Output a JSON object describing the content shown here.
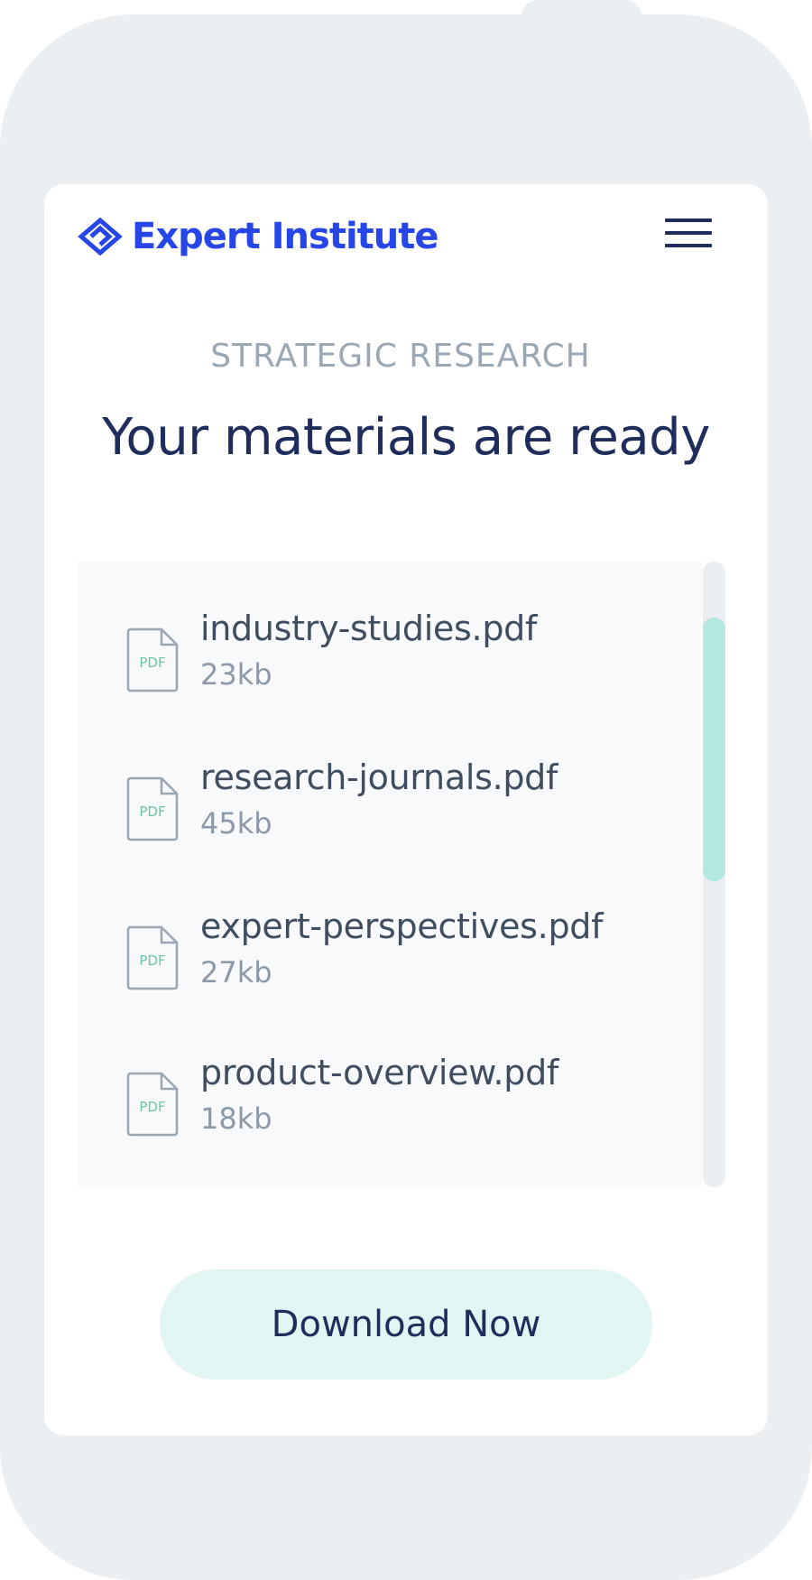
{
  "brand": {
    "name": "Expert Institute",
    "icon": "expert-institute-logo-mark",
    "color": "#2746e8"
  },
  "header": {
    "menu_icon": "hamburger-menu-icon"
  },
  "hero": {
    "eyebrow": "STRATEGIC RESEARCH",
    "title": "Your materials are ready"
  },
  "files": [
    {
      "name": "industry-studies.pdf",
      "size": "23kb",
      "icon_label": "PDF",
      "icon": "pdf-file-icon"
    },
    {
      "name": "research-journals.pdf",
      "size": "45kb",
      "icon_label": "PDF",
      "icon": "pdf-file-icon"
    },
    {
      "name": "expert-perspectives.pdf",
      "size": "27kb",
      "icon_label": "PDF",
      "icon": "pdf-file-icon"
    },
    {
      "name": "product-overview.pdf",
      "size": "18kb",
      "icon_label": "PDF",
      "icon": "pdf-file-icon"
    }
  ],
  "actions": {
    "download_label": "Download Now"
  },
  "colors": {
    "heading": "#1e2d5b",
    "muted": "#9aa7b4",
    "accent_teal": "#b4e7e1",
    "button_bg": "#e1f5f3",
    "pdf_label": "#6cc6a3"
  }
}
